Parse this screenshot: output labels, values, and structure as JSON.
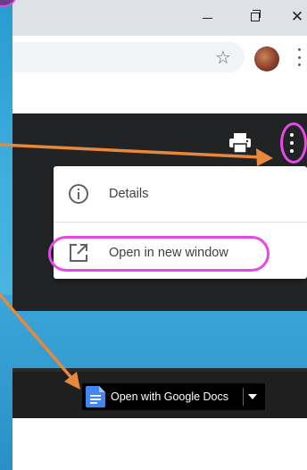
{
  "titlebar": {
    "controls": [
      "minimize",
      "maximize",
      "close"
    ]
  },
  "toolbar": {
    "icons": [
      "star-icon",
      "avatar",
      "more-vert-icon"
    ]
  },
  "viewer": {
    "icons": [
      "print-icon",
      "more-vert-icon"
    ],
    "menu": {
      "items": [
        {
          "label": "Details",
          "icon": "info-icon"
        },
        {
          "label": "Open in new window",
          "icon": "open-in-new-icon"
        }
      ]
    }
  },
  "bottom_bar": {
    "open_with_label": "Open with Google Docs",
    "icon": "google-docs-icon"
  },
  "colors": {
    "annotation_pink": "#e64ae6",
    "arrow_orange": "#e8883a",
    "docs_blue": "#4285f4",
    "viewer_dark": "#222325"
  }
}
